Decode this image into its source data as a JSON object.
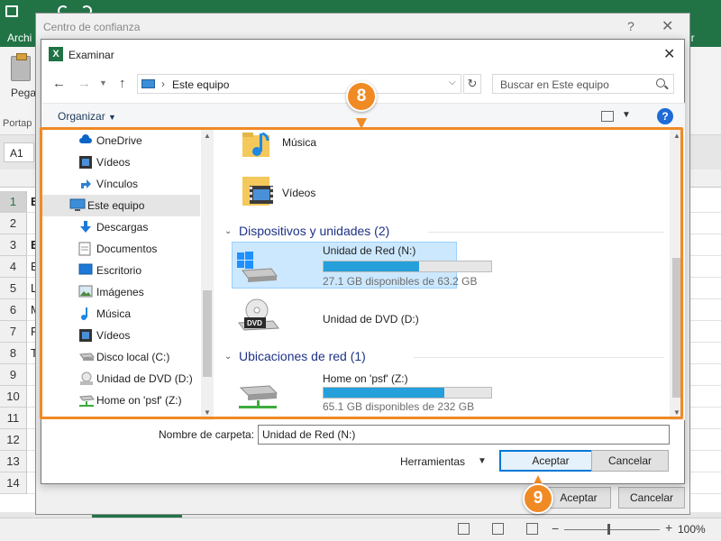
{
  "excel": {
    "file_tab": "Archi",
    "right_tab": "ir",
    "paste_label": "Pega",
    "group_label": "Portap",
    "namebox": "A1",
    "rows": [
      "1",
      "2",
      "3",
      "4",
      "5",
      "6",
      "7",
      "8",
      "9",
      "10",
      "11",
      "12",
      "13",
      "14"
    ],
    "cell_chars": [
      "E",
      "",
      "E",
      "E",
      "L",
      "M",
      "F",
      "T",
      "",
      "",
      "",
      "",
      "",
      ""
    ],
    "zoom": "100%"
  },
  "trust_center": {
    "title": "Centro de confianza",
    "help": "?",
    "close": "✕",
    "ok_label": "Aceptar",
    "cancel_label": "Cancelar"
  },
  "browse": {
    "app_icon": "X",
    "title": "Examinar",
    "close": "✕",
    "address": "Este equipo",
    "search_placeholder": "Buscar en Este equipo",
    "organize": "Organizar",
    "help": "?",
    "nav_items": [
      {
        "label": "OneDrive",
        "icon": "cloud-icon"
      },
      {
        "label": "Vídeos",
        "icon": "film-icon"
      },
      {
        "label": "Vínculos",
        "icon": "link-arrow-icon"
      },
      {
        "label": "Este equipo",
        "icon": "computer-icon"
      },
      {
        "label": "Descargas",
        "icon": "download-icon"
      },
      {
        "label": "Documentos",
        "icon": "document-icon"
      },
      {
        "label": "Escritorio",
        "icon": "desktop-icon"
      },
      {
        "label": "Imágenes",
        "icon": "image-icon"
      },
      {
        "label": "Música",
        "icon": "music-icon"
      },
      {
        "label": "Vídeos",
        "icon": "film-icon"
      },
      {
        "label": "Disco local (C:)",
        "icon": "hard-drive-icon"
      },
      {
        "label": "Unidad de DVD (D:)",
        "icon": "dvd-icon"
      },
      {
        "label": "Home on 'psf' (Z:)",
        "icon": "network-drive-icon"
      }
    ],
    "selected_nav": "Este equipo",
    "folders": [
      {
        "label": "Música",
        "icon": "music-folder-icon"
      },
      {
        "label": "Vídeos",
        "icon": "video-folder-icon"
      }
    ],
    "devices_group": "Dispositivos y unidades (2)",
    "devices": [
      {
        "label": "Unidad de Red (N:)",
        "detail": "27.1 GB disponibles de 63.2 GB",
        "used_fraction": 0.57,
        "icon": "windows-drive-icon"
      },
      {
        "label": "Unidad de DVD (D:)",
        "icon": "dvd-drive-icon"
      }
    ],
    "network_group": "Ubicaciones de red (1)",
    "network": [
      {
        "label": "Home on 'psf' (Z:)",
        "detail": "65.1 GB disponibles de 232 GB",
        "used_fraction": 0.72,
        "icon": "network-drive-icon"
      }
    ],
    "folder_name_label": "Nombre de carpeta:",
    "folder_name_value": "Unidad de Red (N:)",
    "tools_label": "Herramientas",
    "ok_label": "Aceptar",
    "cancel_label": "Cancelar"
  },
  "callouts": {
    "step8": "8",
    "step9": "9",
    "color": "#f08a24"
  }
}
